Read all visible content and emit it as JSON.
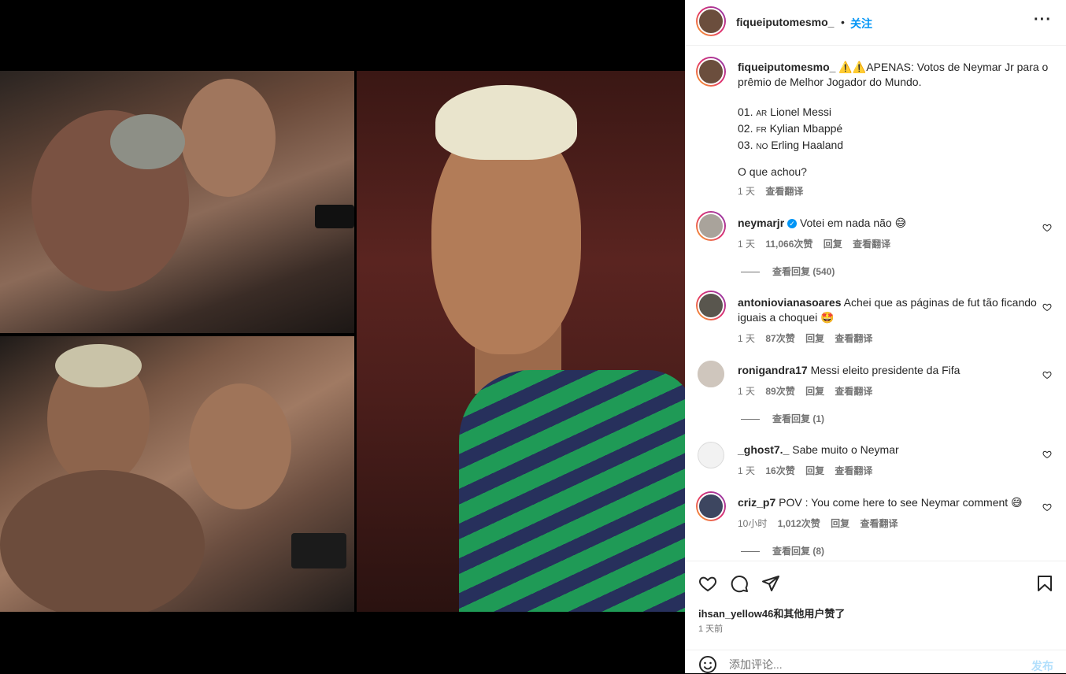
{
  "post": {
    "username": "fiqueiputomesmo_",
    "separator": "•",
    "follow_label": "关注",
    "more_label": "···",
    "caption": {
      "username": "fiqueiputomesmo_",
      "line1": "⚠️⚠️APENAS: Votos de Neymar Jr para o",
      "line2": "prêmio de Melhor Jogador do Mundo.",
      "list": [
        {
          "num": "01.",
          "flag": "AR",
          "name": "Lionel Messi"
        },
        {
          "num": "02.",
          "flag": "FR",
          "name": "Kylian Mbappé"
        },
        {
          "num": "03.",
          "flag": "NO",
          "name": "Erling Haaland"
        }
      ],
      "question": "O que achou?",
      "time": "1 天",
      "translate": "查看翻译"
    },
    "comments": [
      {
        "user": "neymarjr",
        "verified": true,
        "text": "Votei em nada não 😅",
        "time": "1 天",
        "likes": "11,066次赞",
        "reply": "回复",
        "translate": "查看翻译",
        "view_replies": "查看回复 (540)"
      },
      {
        "user": "antoniovianasoares",
        "text1": "Achei que as páginas de fut tão ficando",
        "text2": "iguais a choquei 🤩",
        "time": "1 天",
        "likes": "87次赞",
        "reply": "回复",
        "translate": "查看翻译"
      },
      {
        "user": "ronigandra17",
        "text": "Messi eleito presidente da Fifa",
        "time": "1 天",
        "likes": "89次赞",
        "reply": "回复",
        "translate": "查看翻译",
        "view_replies": "查看回复 (1)"
      },
      {
        "user": "_ghost7._",
        "text": "Sabe muito o Neymar",
        "time": "1 天",
        "likes": "16次赞",
        "reply": "回复",
        "translate": "查看翻译"
      },
      {
        "user": "criz_p7",
        "text": "POV : You come here to see Neymar comment 😅",
        "time": "10小时",
        "likes": "1,012次赞",
        "reply": "回复",
        "translate": "查看翻译",
        "view_replies": "查看回复 (8)"
      }
    ],
    "likes_summary": "ihsan_yellow46和其他用户赞了",
    "posted_ago": "1 天前",
    "comment_placeholder": "添加评论...",
    "post_button": "发布"
  },
  "icons": [
    "heart-icon",
    "comment-icon",
    "share-icon",
    "bookmark-icon",
    "emoji-icon",
    "more-icon",
    "verified-icon"
  ],
  "colors": {
    "accent": "#0095f6",
    "muted": "#737373",
    "text": "#262626",
    "post_disabled": "#b2dffc"
  }
}
